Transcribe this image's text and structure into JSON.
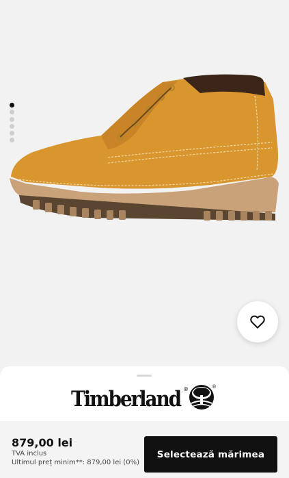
{
  "gallery": {
    "image_alt": "product-photo",
    "dot_count": 6,
    "active_index": 0
  },
  "wishlist": {
    "icon": "heart-icon"
  },
  "brand": {
    "name": "Timberland",
    "registered_mark": "®"
  },
  "footer": {
    "price": "879,00 lei",
    "vat_label": "TVA inclus",
    "min_price_label": "Ultimul preț minim**: 879,00 lei (0%)",
    "cta_label": "Selectează mărimea"
  },
  "colors": {
    "accent": "#111111",
    "background": "#f1f1f1",
    "boot": "#d9962f",
    "sole": "#c9a27a"
  }
}
